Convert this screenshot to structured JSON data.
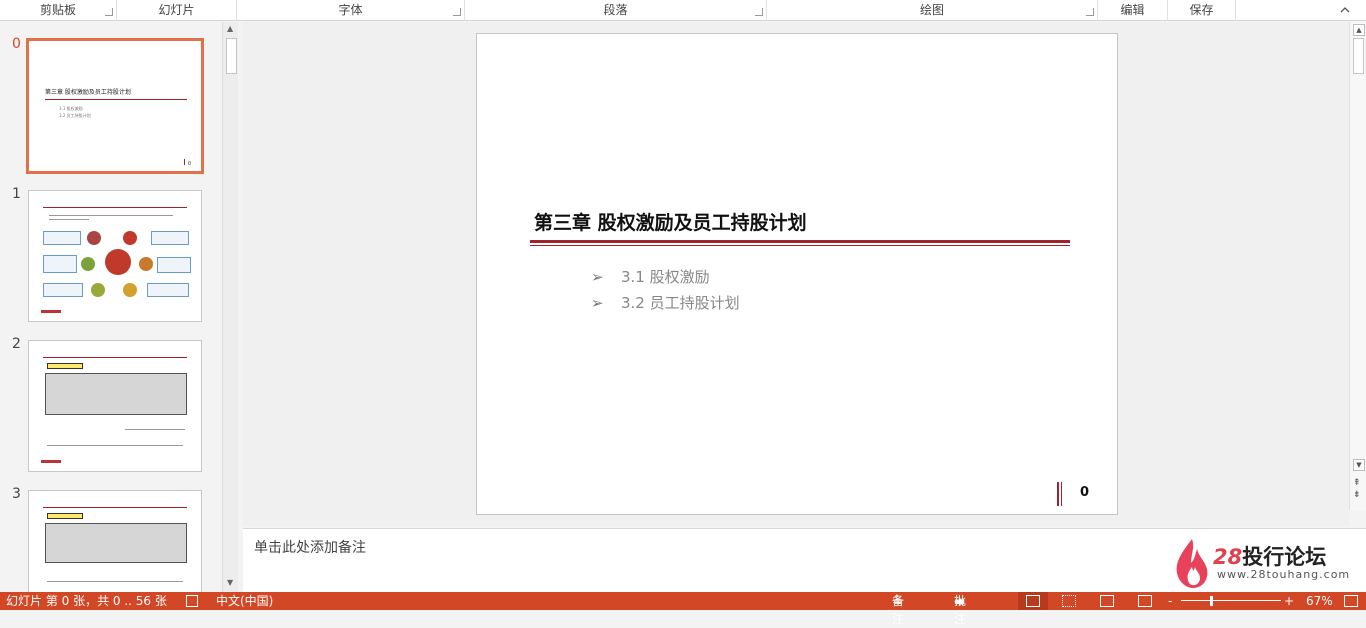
{
  "ribbon": {
    "groups": [
      "剪贴板",
      "幻灯片",
      "字体",
      "段落",
      "绘图",
      "编辑",
      "保存"
    ]
  },
  "thumbnails": {
    "numbers": [
      "0",
      "1",
      "2",
      "3"
    ],
    "slide0": {
      "title": "第三章  股权激励及员工持股计划",
      "items": [
        "3.1  股权激励",
        "3.2  员工持股计划"
      ],
      "page": "0"
    }
  },
  "slide": {
    "title": "第三章  股权激励及员工持股计划",
    "items": [
      "3.1  股权激励",
      "3.2  员工持股计划"
    ],
    "bullet": "➢",
    "page_number": "0"
  },
  "notes": {
    "placeholder": "单击此处添加备注"
  },
  "watermark": {
    "brand_num": "28",
    "brand_text": "投行论坛",
    "url": "www.28touhang.com"
  },
  "status": {
    "slide_info": "幻灯片 第 0 张，共 0 .. 56 张",
    "language": "中文(中国)",
    "notes_btn": "备注",
    "comments_btn": "批注",
    "zoom_minus": "-",
    "zoom_plus": "+",
    "zoom": "67%"
  },
  "colors": {
    "accent": "#d24726",
    "rule": "#a0222a",
    "selected_border": "#e0714b"
  }
}
